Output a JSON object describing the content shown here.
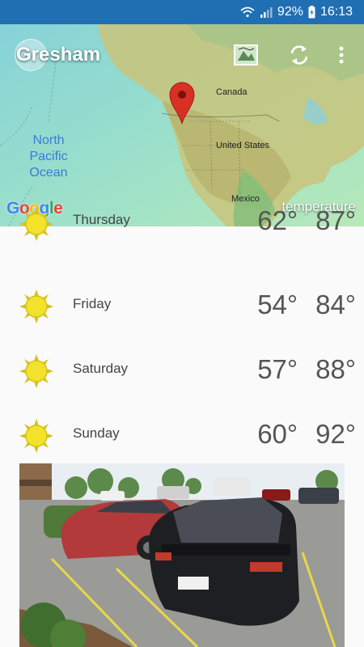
{
  "status": {
    "battery": "92%",
    "time": "16:13"
  },
  "header": {
    "city": "Gresham",
    "layer": "temperature"
  },
  "map": {
    "labels": {
      "ocean": [
        "North",
        "Pacific",
        "Ocean"
      ],
      "canada": "Canada",
      "usa": "United States",
      "mexico": "Mexico"
    },
    "google": [
      "G",
      "o",
      "o",
      "g",
      "l",
      "e"
    ],
    "google_colors": [
      "#4285F4",
      "#EA4335",
      "#FBBC05",
      "#4285F4",
      "#34A853",
      "#EA4335"
    ]
  },
  "forecast": [
    {
      "day": "Thursday",
      "low": "62°",
      "high": "87°"
    },
    {
      "day": "Friday",
      "low": "54°",
      "high": "84°"
    },
    {
      "day": "Saturday",
      "low": "57°",
      "high": "88°"
    },
    {
      "day": "Sunday",
      "low": "60°",
      "high": "92°"
    }
  ],
  "colors": {
    "status_bar": "#1f6fb2",
    "sun": "#f2e22b",
    "marker": "#d93025"
  }
}
